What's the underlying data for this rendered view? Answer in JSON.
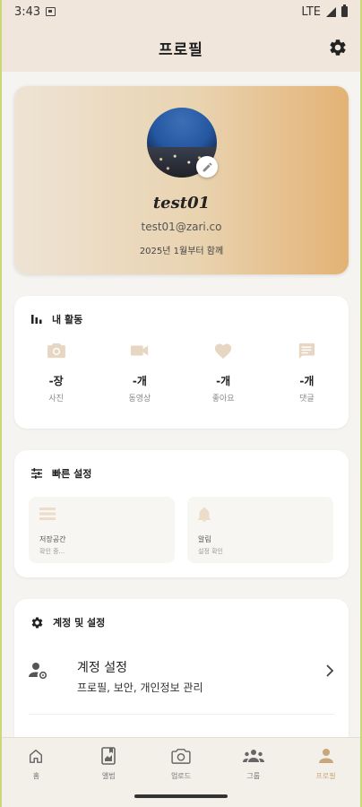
{
  "status_bar": {
    "time": "3:43",
    "network": "LTE"
  },
  "header": {
    "title": "프로필"
  },
  "profile": {
    "username": "test01",
    "email": "test01@zari.co",
    "joined": "2025년 1월부터 함께"
  },
  "activity": {
    "title": "내 활동",
    "items": [
      {
        "icon": "camera-icon",
        "value": "-장",
        "label": "사진"
      },
      {
        "icon": "video-icon",
        "value": "-개",
        "label": "동영상"
      },
      {
        "icon": "heart-icon",
        "value": "-개",
        "label": "좋아요"
      },
      {
        "icon": "comment-icon",
        "value": "-개",
        "label": "댓글"
      }
    ]
  },
  "quick_settings": {
    "title": "빠른 설정",
    "tiles": [
      {
        "icon": "list-icon",
        "title": "저장공간",
        "subtitle": "확인 중..."
      },
      {
        "icon": "bell-icon",
        "title": "알림",
        "subtitle": "설정 확인"
      }
    ]
  },
  "account": {
    "title": "계정 및 설정",
    "row_title": "계정 설정",
    "row_subtitle": "프로필, 보안, 개인정보 관리"
  },
  "bottom_nav": [
    {
      "icon": "home-icon",
      "label": "홈",
      "active": false
    },
    {
      "icon": "album-icon",
      "label": "앨범",
      "active": false
    },
    {
      "icon": "camera-icon",
      "label": "업로드",
      "active": false
    },
    {
      "icon": "group-icon",
      "label": "그룹",
      "active": false
    },
    {
      "icon": "person-icon",
      "label": "프로필",
      "active": true
    }
  ],
  "colors": {
    "accent": "#c9a77b",
    "gradient_end": "#e3b274",
    "header_bg": "#f0e6db"
  }
}
